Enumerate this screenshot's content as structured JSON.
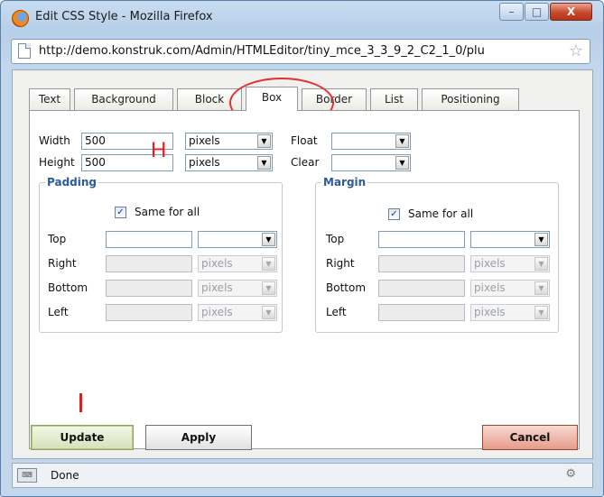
{
  "window": {
    "title": "Edit CSS Style - Mozilla Firefox",
    "url": "http://demo.konstruk.com/Admin/HTMLEditor/tiny_mce_3_3_9_2_C2_1_0/plu",
    "minimize": "–",
    "maximize": "□",
    "close": "X"
  },
  "tabs": [
    "Text",
    "Background",
    "Block",
    "Box",
    "Border",
    "List",
    "Positioning"
  ],
  "active_tab": "Box",
  "box": {
    "width_label": "Width",
    "width_value": "500",
    "width_unit": "pixels",
    "height_label": "Height",
    "height_value": "500",
    "height_unit": "pixels",
    "float_label": "Float",
    "float_value": "",
    "clear_label": "Clear",
    "clear_value": ""
  },
  "padding": {
    "legend": "Padding",
    "same_label": "Same for all",
    "rows": [
      {
        "label": "Top",
        "value": "",
        "unit": ""
      },
      {
        "label": "Right",
        "value": "",
        "unit": "pixels"
      },
      {
        "label": "Bottom",
        "value": "",
        "unit": "pixels"
      },
      {
        "label": "Left",
        "value": "",
        "unit": "pixels"
      }
    ]
  },
  "margin": {
    "legend": "Margin",
    "same_label": "Same for all",
    "rows": [
      {
        "label": "Top",
        "value": "",
        "unit": ""
      },
      {
        "label": "Right",
        "value": "",
        "unit": "pixels"
      },
      {
        "label": "Bottom",
        "value": "",
        "unit": "pixels"
      },
      {
        "label": "Left",
        "value": "",
        "unit": "pixels"
      }
    ]
  },
  "buttons": {
    "update": "Update",
    "apply": "Apply",
    "cancel": "Cancel"
  },
  "annotations": {
    "h_mark": "H"
  },
  "status": {
    "text": "Done"
  },
  "colors": {
    "accent": "#2c5aa0",
    "annotation": "#e02020"
  }
}
